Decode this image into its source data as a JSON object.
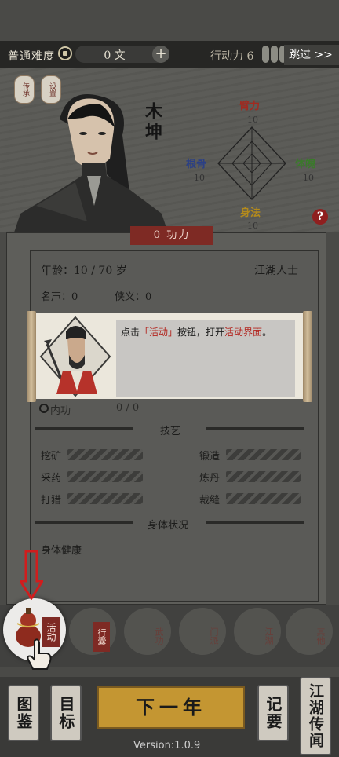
{
  "topbar": {
    "difficulty": "普通难度",
    "coins": "0 文",
    "add": "+",
    "action_points_label": "行动力 6",
    "action_points": 6,
    "skip": "跳过 >>"
  },
  "tags": [
    "传承",
    "设置"
  ],
  "character": {
    "name": "木坤"
  },
  "stats": [
    {
      "label": "臂力",
      "value": "10",
      "color": "#a12a20"
    },
    {
      "label": "根骨",
      "value": "10",
      "color": "#2a3f86"
    },
    {
      "label": "体魄",
      "value": "10",
      "color": "#3a7a2a"
    },
    {
      "label": "身法",
      "value": "10",
      "color": "#b38a1c"
    }
  ],
  "gongli": "0 功力",
  "info": {
    "age": "年龄：10 / 70 岁",
    "origin": "江湖人士",
    "fame": "名声：0",
    "chivalry": "侠义：0",
    "neigong": "内功",
    "neigong_value": "0 / 0"
  },
  "tutorial": {
    "p1": "点击",
    "p2": "「活动」",
    "p3": "按钮，打开",
    "p4": "活动界面",
    "p5": "。"
  },
  "skills_title": "技艺",
  "skills": {
    "left": [
      "挖矿",
      "采药",
      "打猎"
    ],
    "right": [
      "锻造",
      "炼丹",
      "裁缝"
    ]
  },
  "health_title": "身体状况",
  "health": "身体健康",
  "activities": [
    {
      "label": "活动"
    },
    {
      "label": "行囊"
    },
    {
      "label": "武功"
    },
    {
      "label": "门派"
    },
    {
      "label": "江湖"
    },
    {
      "label": "其他"
    }
  ],
  "bottom": {
    "tujian": "图鉴",
    "mubiao": "目标",
    "next_year": "下一年",
    "jiyao": "记要",
    "legend": "江湖传闻",
    "version": "Version:1.0.9"
  }
}
